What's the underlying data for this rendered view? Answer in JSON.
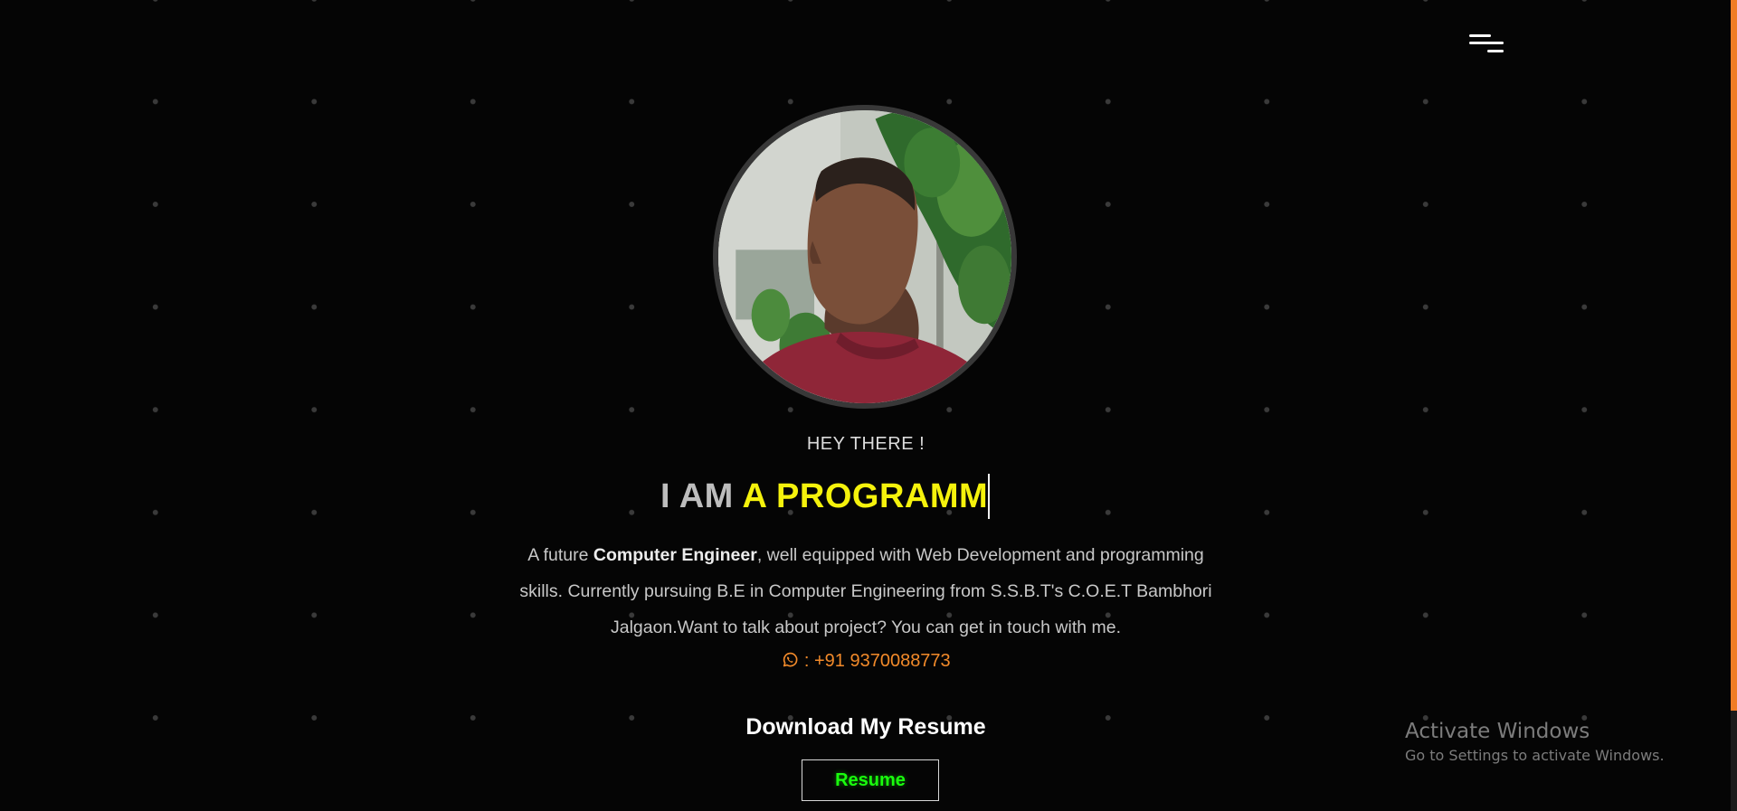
{
  "nav": {
    "menu_icon": "hamburger-menu-icon"
  },
  "hero": {
    "greeting": "HEY THERE !",
    "headline_lead": "I AM ",
    "headline_typed": "A PROGRAMM",
    "bio_part1": "A future ",
    "bio_bold": "Computer Engineer",
    "bio_part2": ", well equipped with Web Development and programming skills. Currently pursuing B.E in Computer Engineering from S.S.B.T's C.O.E.T Bambhori Jalgaon.Want to talk about project? You can get in touch with me.",
    "phone_icon": "whatsapp-icon",
    "phone_text": " : +91 9370088773"
  },
  "resume": {
    "heading": "Download My Resume",
    "button_label": "Resume"
  },
  "watermark": {
    "title": "Activate Windows",
    "subtitle": "Go to Settings to activate Windows."
  },
  "colors": {
    "background": "#050505",
    "accent_orange": "#f28a2a",
    "headline_yellow": "#f5f20c",
    "resume_green": "#19ff0d"
  }
}
